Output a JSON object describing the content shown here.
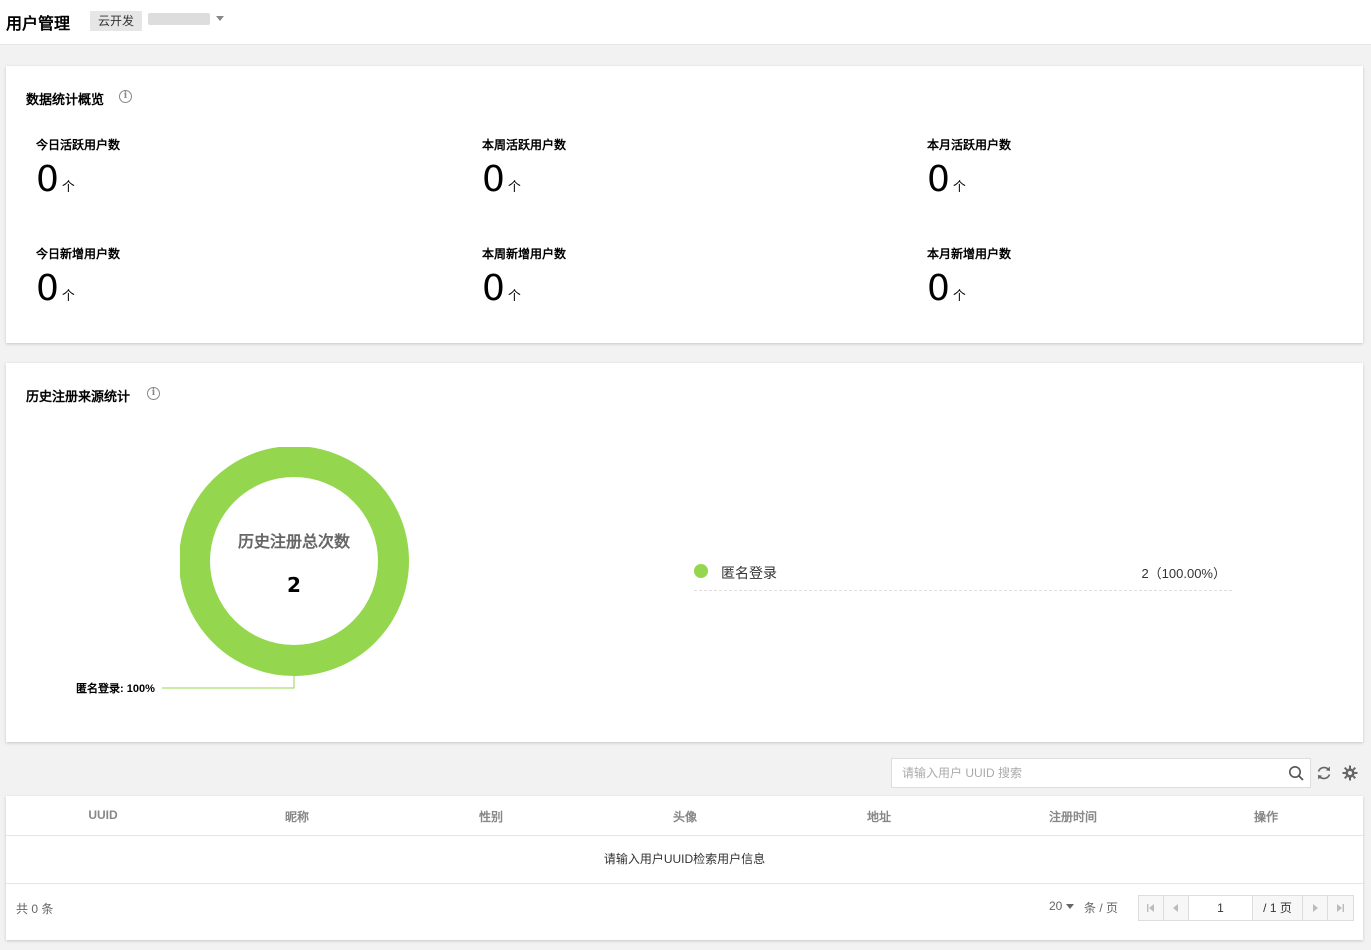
{
  "header": {
    "title": "用户管理",
    "env_tag": "云开发"
  },
  "overview": {
    "title": "数据统计概览",
    "stats": [
      {
        "label": "今日活跃用户数",
        "value": "0",
        "unit": "个"
      },
      {
        "label": "本周活跃用户数",
        "value": "0",
        "unit": "个"
      },
      {
        "label": "本月活跃用户数",
        "value": "0",
        "unit": "个"
      },
      {
        "label": "今日新增用户数",
        "value": "0",
        "unit": "个"
      },
      {
        "label": "本周新增用户数",
        "value": "0",
        "unit": "个"
      },
      {
        "label": "本月新增用户数",
        "value": "0",
        "unit": "个"
      }
    ]
  },
  "source": {
    "title": "历史注册来源统计",
    "center_label": "历史注册总次数",
    "center_value": "2",
    "callout": "匿名登录: 100%",
    "legend": [
      {
        "name": "匿名登录",
        "value": "2（100.00%）"
      }
    ]
  },
  "chart_data": {
    "type": "pie",
    "title": "",
    "categories": [
      "匿名登录"
    ],
    "values": [
      2
    ],
    "percentages": [
      100
    ],
    "colors": [
      "#95d64f"
    ]
  },
  "search": {
    "placeholder": "请输入用户 UUID 搜索"
  },
  "table": {
    "columns": [
      "UUID",
      "昵称",
      "性别",
      "头像",
      "地址",
      "注册时间",
      "操作"
    ],
    "empty_text": "请输入用户UUID检索用户信息"
  },
  "pagination": {
    "total_text": "共 0 条",
    "page_size": "20",
    "per_page_label": "条 / 页",
    "current_page": "1",
    "total_pages_text": "/ 1 页"
  },
  "colors": {
    "accent_green": "#95d64f"
  }
}
